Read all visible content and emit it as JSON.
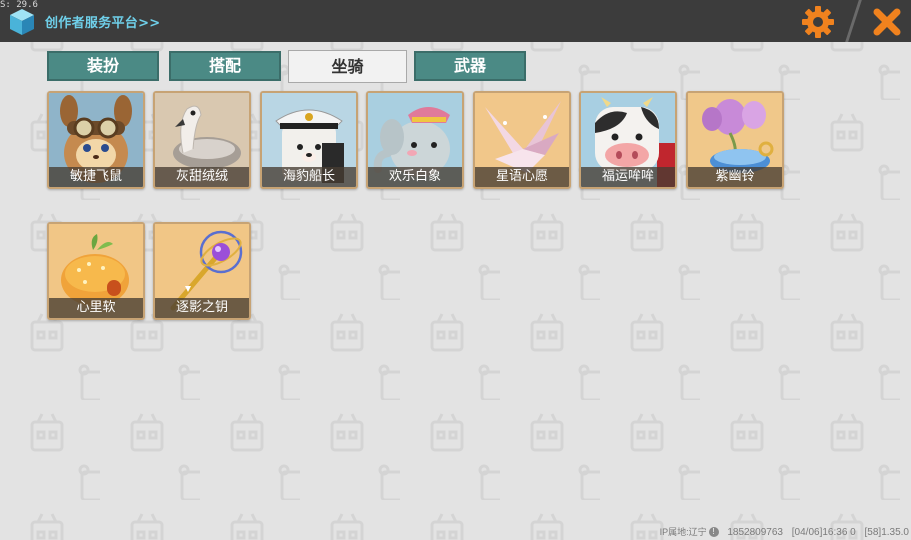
{
  "topbar": {
    "fps": "S: 29.6",
    "title": "创作者服务平台>>"
  },
  "tabs": [
    {
      "label": "装扮",
      "active": false
    },
    {
      "label": "搭配",
      "active": false
    },
    {
      "label": "坐骑",
      "active": true
    },
    {
      "label": "武器",
      "active": false
    }
  ],
  "items": [
    {
      "label": "敏捷飞鼠",
      "icon": "flying-squirrel-icon"
    },
    {
      "label": "灰甜绒绒",
      "icon": "gray-swan-icon"
    },
    {
      "label": "海豹船长",
      "icon": "seal-captain-icon"
    },
    {
      "label": "欢乐白象",
      "icon": "white-elephant-icon"
    },
    {
      "label": "星语心愿",
      "icon": "paper-crane-icon"
    },
    {
      "label": "福运哞哞",
      "icon": "cow-icon"
    },
    {
      "label": "紫幽铃",
      "icon": "purple-bell-icon"
    },
    {
      "label": "心里软",
      "icon": "bun-house-icon"
    },
    {
      "label": "逐影之钥",
      "icon": "shadow-key-icon"
    }
  ],
  "status": {
    "ip": "IP属地:辽宁",
    "uid": "1852809763",
    "datetime": "[04/06]16:36 0",
    "version": "[58]1.35.0"
  },
  "colors": {
    "topbar": "#3c3c3c",
    "title": "#6fd0ea",
    "tab": "#4b8a85",
    "accent_orange": "#f0821e",
    "item_border": "#c7a374"
  }
}
